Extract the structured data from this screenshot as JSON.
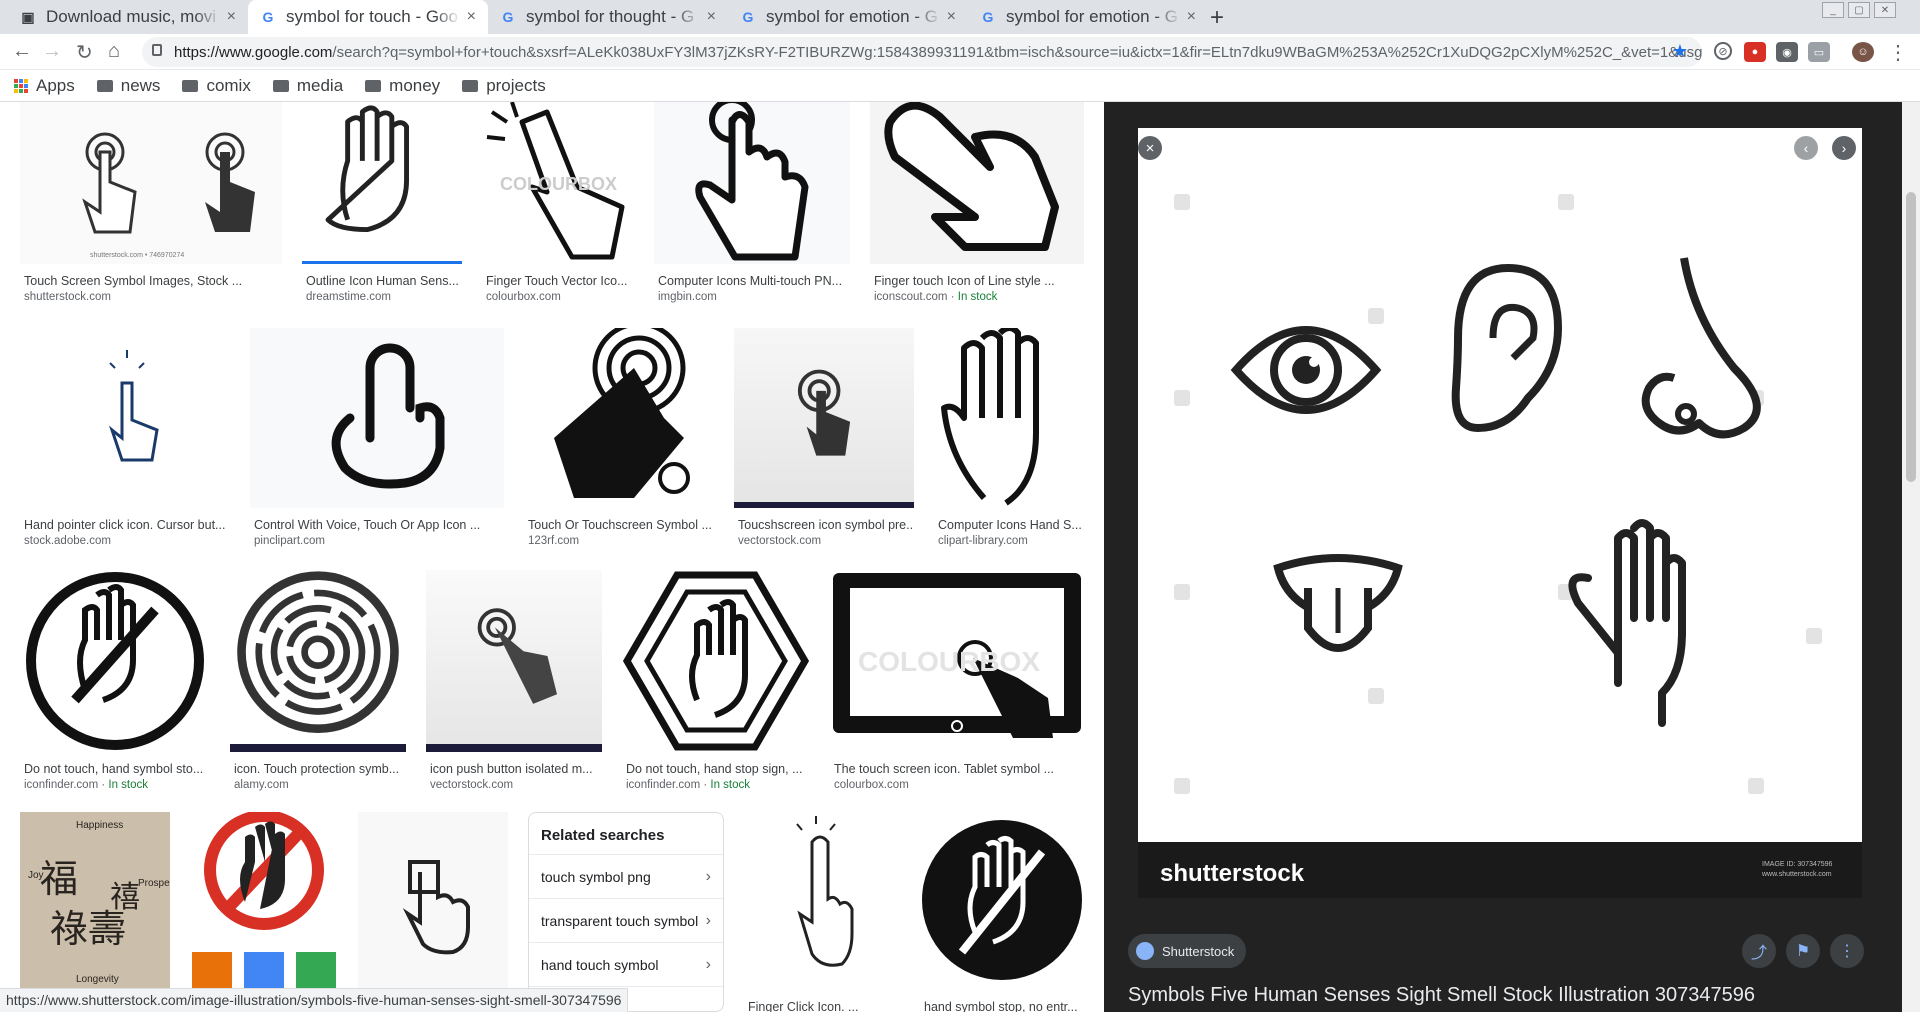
{
  "tabs": [
    {
      "label": "Download music, movi",
      "active": false
    },
    {
      "label": "symbol for touch - Goo",
      "active": true
    },
    {
      "label": "symbol for thought - G",
      "active": false
    },
    {
      "label": "symbol for emotion - G",
      "active": false
    },
    {
      "label": "symbol for emotion - G",
      "active": false
    }
  ],
  "url": {
    "host": "https://www.google.com",
    "rest": "/search?q=symbol+for+touch&sxsrf=ALeKk038UxFY3lM37jZKsRY-F2TIBURZWg:1584389931191&tbm=isch&source=iu&ictx=1&fir=ELtn7dku9WBaGM%253A%252Cr1XuDQG2pCXlyM%252C_&vet=1&usg=AI4_-k..."
  },
  "bookmarks": [
    "Apps",
    "news",
    "comix",
    "media",
    "money",
    "projects"
  ],
  "results": [
    {
      "caption": "Touch Screen Symbol Images, Stock ...",
      "domain": "shutterstock.com",
      "stock": ""
    },
    {
      "caption": "Outline Icon Human Sens...",
      "domain": "dreamstime.com",
      "stock": ""
    },
    {
      "caption": "Finger Touch Vector Ico...",
      "domain": "colourbox.com",
      "stock": ""
    },
    {
      "caption": "Computer Icons Multi-touch PN...",
      "domain": "imgbin.com",
      "stock": ""
    },
    {
      "caption": "Finger touch Icon of Line style ...",
      "domain": "iconscout.com",
      "stock": "In stock"
    },
    {
      "caption": "Hand pointer click icon. Cursor but...",
      "domain": "stock.adobe.com",
      "stock": ""
    },
    {
      "caption": "Control With Voice, Touch Or App Icon ...",
      "domain": "pinclipart.com",
      "stock": ""
    },
    {
      "caption": "Touch Or Touchscreen Symbol ...",
      "domain": "123rf.com",
      "stock": ""
    },
    {
      "caption": "Toucshscreen icon symbol pre...",
      "domain": "vectorstock.com",
      "stock": ""
    },
    {
      "caption": "Computer Icons Hand S...",
      "domain": "clipart-library.com",
      "stock": ""
    },
    {
      "caption": "Do not touch, hand symbol sto...",
      "domain": "iconfinder.com",
      "stock": "In stock"
    },
    {
      "caption": "icon. Touch protection symb...",
      "domain": "alamy.com",
      "stock": ""
    },
    {
      "caption": "icon push button isolated m...",
      "domain": "vectorstock.com",
      "stock": ""
    },
    {
      "caption": "Do not touch, hand stop sign, ...",
      "domain": "iconfinder.com",
      "stock": "In stock"
    },
    {
      "caption": "The touch screen icon. Tablet symbol ...",
      "domain": "colourbox.com",
      "stock": ""
    },
    {
      "caption": "Finger Click Icon. ...",
      "domain": "",
      "stock": ""
    },
    {
      "caption": "hand symbol stop, no entr...",
      "domain": "",
      "stock": ""
    }
  ],
  "image_text": {
    "stamp": "shutterstock.com • 746970274",
    "colourbox": "COLOURBOX",
    "calligraphy": [
      "Happiness",
      "Joy",
      "Prosper",
      "Longevity"
    ]
  },
  "related": {
    "heading": "Related searches",
    "items": [
      "touch symbol png",
      "transparent touch symbol",
      "hand touch symbol"
    ]
  },
  "status_url": "https://www.shutterstock.com/image-illustration/symbols-five-human-senses-sight-smell-307347596",
  "panel": {
    "source": "Shutterstock",
    "title": "Symbols Five Human Senses Sight Smell Stock Illustration 307347596",
    "logo": "shutterstock",
    "image_id_label": "IMAGE ID: 307347596",
    "image_site": "www.shutterstock.com"
  },
  "colors": {
    "accent": "#1a73e8",
    "in_stock": "#188038",
    "panel_bg": "#222222"
  }
}
